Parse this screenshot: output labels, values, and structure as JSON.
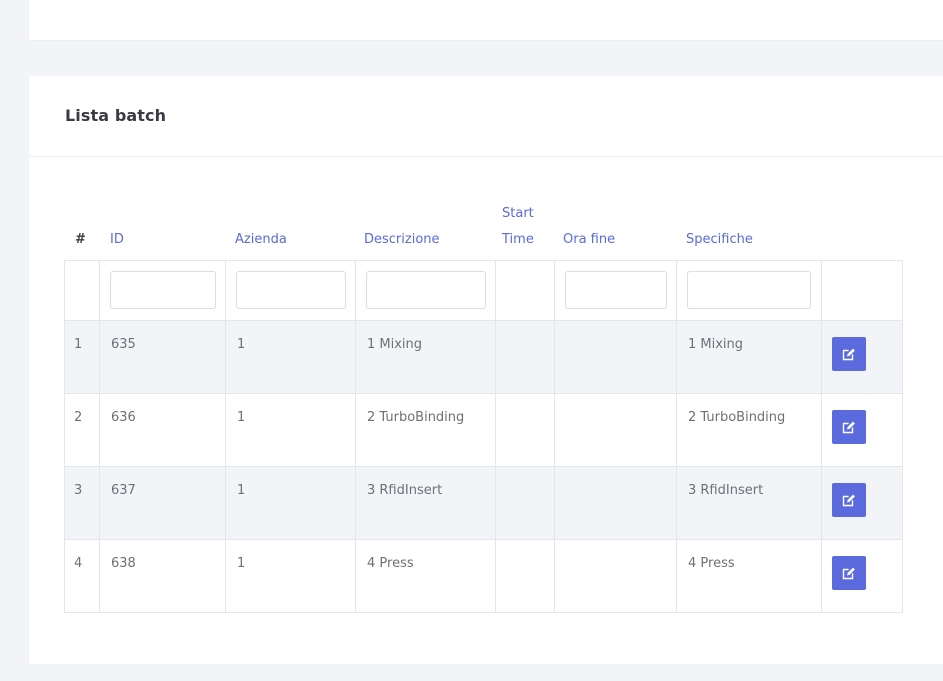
{
  "card": {
    "title": "Lista batch"
  },
  "table": {
    "headers": {
      "hash": "#",
      "id": "ID",
      "azienda": "Azienda",
      "descrizione": "Descrizione",
      "start_time_line1": "Start",
      "start_time_line2": "Time",
      "ora_fine": "Ora fine",
      "specifiche": "Specifiche"
    },
    "rows": [
      {
        "num": "1",
        "id": "635",
        "azienda": "1",
        "descrizione": "1 Mixing",
        "start_time": "",
        "ora_fine": "",
        "specifiche": "1 Mixing"
      },
      {
        "num": "2",
        "id": "636",
        "azienda": "1",
        "descrizione": "2 TurboBinding",
        "start_time": "",
        "ora_fine": "",
        "specifiche": "2 TurboBinding"
      },
      {
        "num": "3",
        "id": "637",
        "azienda": "1",
        "descrizione": "3 RfidInsert",
        "start_time": "",
        "ora_fine": "",
        "specifiche": "3 RfidInsert"
      },
      {
        "num": "4",
        "id": "638",
        "azienda": "1",
        "descrizione": "4 Press",
        "start_time": "",
        "ora_fine": "",
        "specifiche": "4 Press"
      }
    ],
    "edit_icon": "pencil-square-icon"
  },
  "colors": {
    "accent": "#5b6bdd",
    "header_link": "#5a6ad8",
    "row_stripe": "#f3f4f8",
    "page_bg": "#f3f4f8"
  }
}
